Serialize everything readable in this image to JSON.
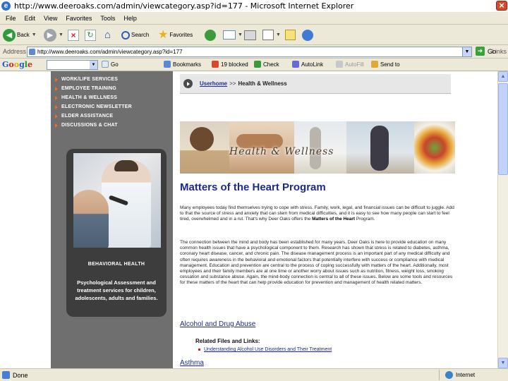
{
  "window": {
    "title": "http://www.deeroaks.com/admin/viewcategory.asp?id=177 - Microsoft Internet Explorer"
  },
  "menu": [
    "File",
    "Edit",
    "View",
    "Favorites",
    "Tools",
    "Help"
  ],
  "toolbar": {
    "back": "Back",
    "search": "Search",
    "favorites": "Favorites"
  },
  "address": {
    "label": "Address",
    "url": "http://www.deeroaks.com/admin/viewcategory.asp?id=177",
    "go": "Go",
    "links": "Links"
  },
  "google": {
    "logo": [
      "G",
      "o",
      "o",
      "g",
      "l",
      "e"
    ],
    "go": "Go",
    "bookmarks": "Bookmarks",
    "blocked": "19 blocked",
    "check": "Check",
    "autolink": "AutoLink",
    "autofill": "AutoFill",
    "sendto": "Send to"
  },
  "nav": [
    "WORK/LIFE SERVICES",
    "EMPLOYEE TRAINING",
    "HEALTH & WELLNESS",
    "ELECTRONIC NEWSLETTER",
    "ELDER ASSISTANCE",
    "DISCUSSIONS & CHAT"
  ],
  "promo": {
    "heading": "BEHAVIORAL HEALTH",
    "desc": "Psychological Assessment and treatment services for children, adolescents, adults and families."
  },
  "breadcrumb": {
    "home": "Userhome",
    "sep": ">>",
    "current": "Health & Wellness"
  },
  "banner": {
    "logo": "Health & Wellness"
  },
  "page": {
    "title": "Matters of the Heart Program",
    "p1_pre": "Many employees today find themselves trying to cope with stress. Family, work, legal, and financial issues can be difficult to juggle. Add to that the source of stress and anxiety that can stem from medical difficulties, and it is easy to see how many people can start to feel tired, overwhelmed and in a rut. That's why Deer Oaks offers the ",
    "p1_bold": "Matters of the Heart",
    "p1_post": " Program.",
    "p2": "The connection between the mind and body has been established for many years. Deer Oaks is here to provide education on many common health issues that have a psychological component to them. Research has shown that stress is related to diabetes, asthma, coronary heart disease, cancer, and chronic pain. The disease management process is an important part of any medical difficulty and often requires awareness in the behavioral and emotional factors that potentially interfere with success or compliance with medical management. Education and prevention are central to the process of coping successfully with matters of the heart. Additionally, most employees and their family members are at one time or another worry about issues such as nutrition, fitness, weight loss, smoking cessation and substance abuse. Again, the mind-body connection is central to all of these issues. Below are some tools and resources for these matters of the heart that can help provide education for prevention and management of health related matters.",
    "section1": "Alcohol and Drug Abuse",
    "related": "Related Files and Links:",
    "link1": "Understanding Alcohol Use Disorders and Their Treatment",
    "section2": "Asthma"
  },
  "status": {
    "text": "Done",
    "zone": "Internet"
  },
  "colors": {
    "nav_bullet": "#ef6a2a",
    "heading": "#1c2a8e",
    "left_panel": "#6f6f6f"
  }
}
